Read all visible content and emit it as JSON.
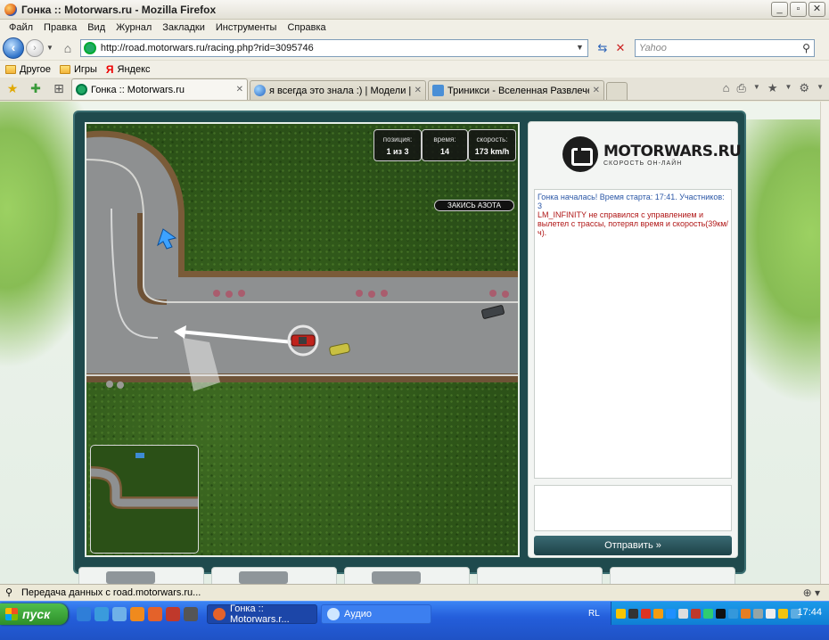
{
  "window": {
    "title": "Гонка :: Motorwars.ru - Mozilla Firefox"
  },
  "menu": [
    "Файл",
    "Правка",
    "Вид",
    "Журнал",
    "Закладки",
    "Инструменты",
    "Справка"
  ],
  "nav": {
    "url": "http://road.motorwars.ru/racing.php?rid=3095746",
    "search_placeholder": "Yahoo"
  },
  "bookmarks": [
    "Другое",
    "Игры",
    "Яндекс"
  ],
  "tabs": [
    {
      "label": "Гонка :: Motorwars.ru",
      "active": true
    },
    {
      "label": "я всегда это знала :) | Модели | ...",
      "active": false
    },
    {
      "label": "Триникси - Вселенная Развлечен...",
      "active": false
    }
  ],
  "game": {
    "hud": {
      "position_label": "позиция:",
      "position_value": "1 из 3",
      "time_label": "время:",
      "time_value": "14",
      "speed_label": "скорость:",
      "speed_value": "173 km/h"
    },
    "nitro_label": "ЗАКИСЬ АЗОТА"
  },
  "panel": {
    "logo_name": "MOTORWARS.RU",
    "logo_sub": "СКОРОСТЬ ОН-ЛАЙН",
    "messages": [
      {
        "text": "Гонка началась! Время старта: 17:41. Участников: 3",
        "style": "blue"
      },
      {
        "text": "LM_INFINITY не справился с управлением и вылетел с трассы, потерял время и скорость(39км/ч).",
        "style": "red"
      }
    ],
    "send_label": "Отправить »"
  },
  "status": {
    "text": "Передача данных с road.motorwars.ru..."
  },
  "taskbar": {
    "start_label": "пуск",
    "tasks": [
      "Гонка :: Motorwars.r...",
      "Аудио"
    ],
    "lang": "RL",
    "clock": "17:44"
  }
}
